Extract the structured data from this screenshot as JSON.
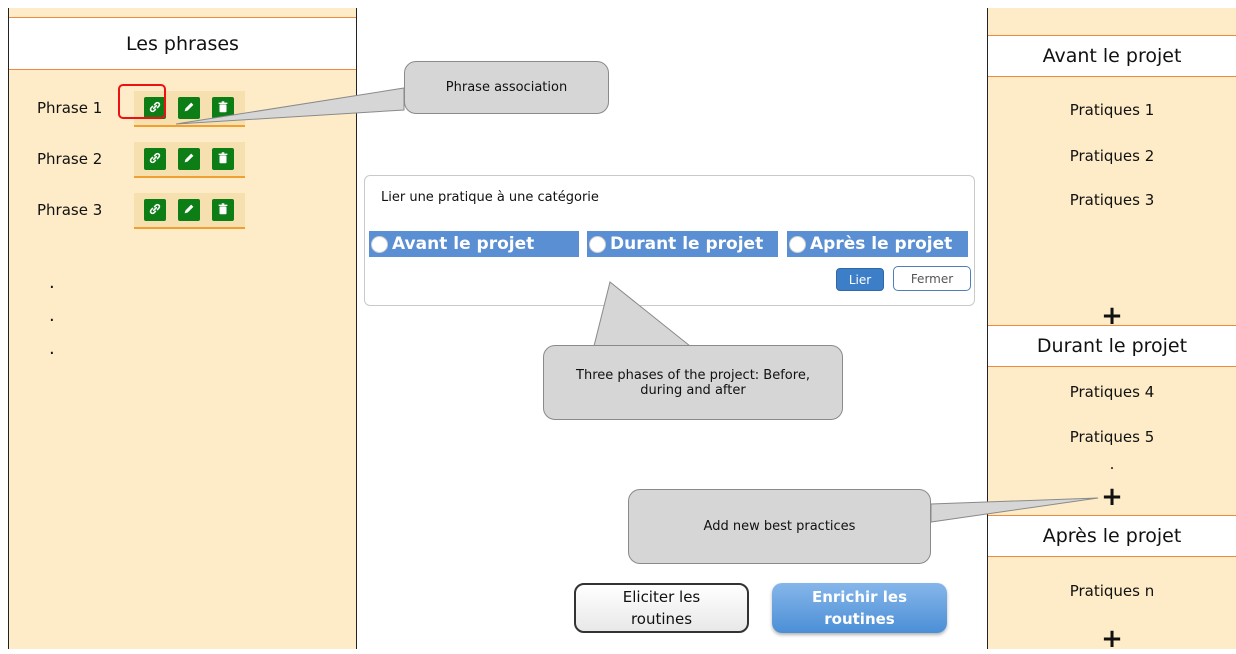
{
  "left_panel": {
    "title": "Les phrases",
    "phrases": [
      {
        "label": "Phrase 1"
      },
      {
        "label": "Phrase 2"
      },
      {
        "label": "Phrase 3"
      }
    ],
    "ellipsis": [
      ".",
      ".",
      "."
    ],
    "icons": [
      "link-icon",
      "pencil-icon",
      "trash-icon"
    ]
  },
  "right_panel": {
    "sections": [
      {
        "title": "Avant le projet",
        "items": [
          "Pratiques 1",
          "Pratiques 2",
          "Pratiques 3"
        ],
        "add": "+"
      },
      {
        "title": "Durant le projet",
        "items": [
          "Pratiques 4",
          "Pratiques 5",
          "."
        ],
        "add": "+"
      },
      {
        "title": "Après le projet",
        "items": [
          "Pratiques n"
        ],
        "add": "+"
      }
    ]
  },
  "dialog": {
    "title": "Lier une pratique à une catégorie",
    "options": [
      "Avant le projet",
      "Durant le projet",
      "Après le projet"
    ],
    "lier_label": "Lier",
    "fermer_label": "Fermer"
  },
  "callouts": {
    "phrase_association": "Phrase association",
    "three_phases": "Three phases of the project: Before, during and after",
    "add_practices": "Add new best practices"
  },
  "buttons": {
    "eliciter": "Eliciter les routines",
    "enrichir": "Enrichir les routines"
  },
  "colors": {
    "panel_bg": "#fdecc7",
    "accent_orange": "#f08a40",
    "icon_green": "#0d7d16",
    "radio_blue": "#5b8fd3",
    "highlight_red": "#e11111"
  }
}
